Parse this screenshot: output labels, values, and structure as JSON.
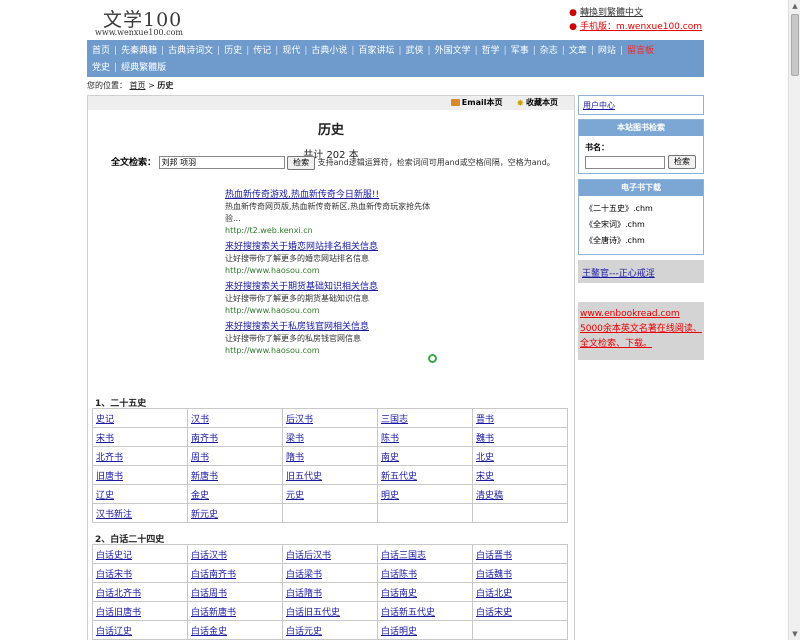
{
  "header": {
    "logo_text": "文学100",
    "logo_url": "www.wenxue100.com",
    "links": [
      {
        "label": "轉換到繁體中文"
      },
      {
        "label": "手机版：m.wenxue100.com"
      }
    ]
  },
  "nav": {
    "row1": [
      "首页",
      "先秦典籍",
      "古典诗词文",
      "历史",
      "传记",
      "现代",
      "古典小说",
      "百家讲坛",
      "武侠",
      "外国文学",
      "哲学",
      "军事",
      "杂志",
      "文章",
      "网站",
      "留言板"
    ],
    "row2": [
      "党史",
      "經典繁體版"
    ]
  },
  "breadcrumb": {
    "prefix": "您的位置：",
    "home": "首页",
    "sep": ">",
    "current": "历史"
  },
  "topbar": {
    "email_label": "Email本页",
    "favorite_label": "收藏本页"
  },
  "main": {
    "title": "历史",
    "total": "共计 202 本",
    "search_label": "全文检索：",
    "search_value": "刘邦 项羽",
    "search_button": "检索",
    "search_hint": "支持and逻辑运算符，检索词间可用and或空格间隔，空格为and。"
  },
  "ads": [
    {
      "title": "热血新传奇游戏,热血新传奇今日新服!!",
      "desc": "热血新传奇网页版,热血新传奇新区,热血新传奇玩家抢先体验...",
      "url": "http://t2.web.kenxi.cn"
    },
    {
      "title": "来好搜搜索关于婚恋网站排名相关信息",
      "desc": "让好搜带你了解更多的婚恋网站排名信息",
      "url": "http://www.haosou.com"
    },
    {
      "title": "来好搜搜索关于期货基础知识相关信息",
      "desc": "让好搜带你了解更多的期货基础知识信息",
      "url": "http://www.haosou.com"
    },
    {
      "title": "来好搜搜索关于私房钱官网相关信息",
      "desc": "让好搜带你了解更多的私房钱官网信息",
      "url": "http://www.haosou.com"
    }
  ],
  "sections": [
    {
      "title": "1、二十五史",
      "rows": [
        [
          "史记",
          "汉书",
          "后汉书",
          "三国志",
          "晋书"
        ],
        [
          "宋书",
          "南齐书",
          "梁书",
          "陈书",
          "魏书"
        ],
        [
          "北齐书",
          "周书",
          "隋书",
          "南史",
          "北史"
        ],
        [
          "旧唐书",
          "新唐书",
          "旧五代史",
          "新五代史",
          "宋史"
        ],
        [
          "辽史",
          "金史",
          "元史",
          "明史",
          "清史稿"
        ],
        [
          "汉书新注",
          "新元史",
          "",
          "",
          ""
        ]
      ]
    },
    {
      "title": "2、白话二十四史",
      "rows": [
        [
          "白话史记",
          "白话汉书",
          "白话后汉书",
          "白话三国志",
          "白话晋书"
        ],
        [
          "白话宋书",
          "白话南齐书",
          "白话梁书",
          "白话陈书",
          "白话魏书"
        ],
        [
          "白话北齐书",
          "白话周书",
          "白话隋书",
          "白话南史",
          "白话北史"
        ],
        [
          "白话旧唐书",
          "白话新唐书",
          "白话旧五代史",
          "白话新五代史",
          "白话宋史"
        ],
        [
          "白话辽史",
          "白话金史",
          "白话元史",
          "白话明史",
          ""
        ]
      ]
    }
  ],
  "sidebar": {
    "user_center": "用户中心",
    "book_search": {
      "title": "本站图书检索",
      "label": "书名：",
      "button": "检索"
    },
    "ebooks": {
      "title": "电子书下载",
      "items": [
        "《二十五史》.chm",
        "《全宋词》.chm",
        "《全唐诗》.chm"
      ]
    },
    "promo1": "王鳌官---正心戒淫",
    "promo2": {
      "url": "www.enbookread.com",
      "text": "5000余本英文名著在线阅读、全文检索、下载。"
    }
  }
}
